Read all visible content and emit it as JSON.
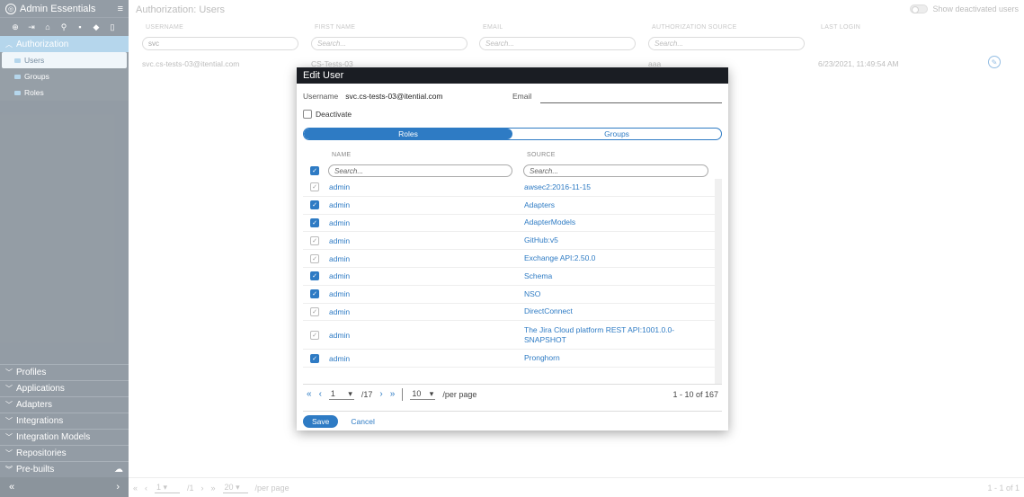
{
  "sidebar": {
    "title": "Admin Essentials",
    "active_section": "Authorization",
    "items": [
      {
        "label": "Users",
        "active": true
      },
      {
        "label": "Groups",
        "active": false
      },
      {
        "label": "Roles",
        "active": false
      }
    ],
    "sections": [
      "Profiles",
      "Applications",
      "Adapters",
      "Integrations",
      "Integration Models",
      "Repositories",
      "Pre-builts"
    ],
    "footer_left": "«",
    "footer_right": "›"
  },
  "main": {
    "title": "Authorization: Users",
    "toggle_label": "Show deactivated users",
    "columns": [
      "USERNAME",
      "FIRST NAME",
      "EMAIL",
      "AUTHORIZATION SOURCE",
      "LAST LOGIN"
    ],
    "filters": {
      "username": "svc",
      "first_name": "Search...",
      "email": "Search...",
      "auth_source": "Search..."
    },
    "row": {
      "username": "svc.cs-tests-03@itential.com",
      "first_name": "CS-Tests-03",
      "auth_source": "aaa",
      "last_login": "6/23/2021, 11:49:54 AM"
    },
    "pager": {
      "page": "1",
      "total_pages": "/1",
      "per_page": "20",
      "per_page_label": "/per page",
      "range": "1 - 1 of 1"
    }
  },
  "modal": {
    "title": "Edit User",
    "username_label": "Username",
    "username": "svc.cs-tests-03@itential.com",
    "email_label": "Email",
    "deactivate_label": "Deactivate",
    "tabs": [
      "Roles",
      "Groups"
    ],
    "grid": {
      "columns": [
        "NAME",
        "SOURCE"
      ],
      "name_placeholder": "Search...",
      "source_placeholder": "Search...",
      "rows": [
        {
          "name": "admin",
          "source": "awsec2:2016-11-15",
          "checked": "dim"
        },
        {
          "name": "admin",
          "source": "Adapters",
          "checked": "on"
        },
        {
          "name": "admin",
          "source": "AdapterModels",
          "checked": "on"
        },
        {
          "name": "admin",
          "source": "GitHub:v5",
          "checked": "dim"
        },
        {
          "name": "admin",
          "source": "Exchange API:2.50.0",
          "checked": "dim"
        },
        {
          "name": "admin",
          "source": "Schema",
          "checked": "on"
        },
        {
          "name": "admin",
          "source": "NSO",
          "checked": "on"
        },
        {
          "name": "admin",
          "source": "DirectConnect",
          "checked": "dim"
        },
        {
          "name": "admin",
          "source": "The Jira Cloud platform REST API:1001.0.0-SNAPSHOT",
          "checked": "dim"
        },
        {
          "name": "admin",
          "source": "Pronghorn",
          "checked": "on"
        }
      ]
    },
    "pager": {
      "page": "1",
      "total_pages": "/17",
      "per_page": "10",
      "per_page_label": "/per page",
      "range": "1 - 10 of 167"
    },
    "save_label": "Save",
    "cancel_label": "Cancel"
  }
}
